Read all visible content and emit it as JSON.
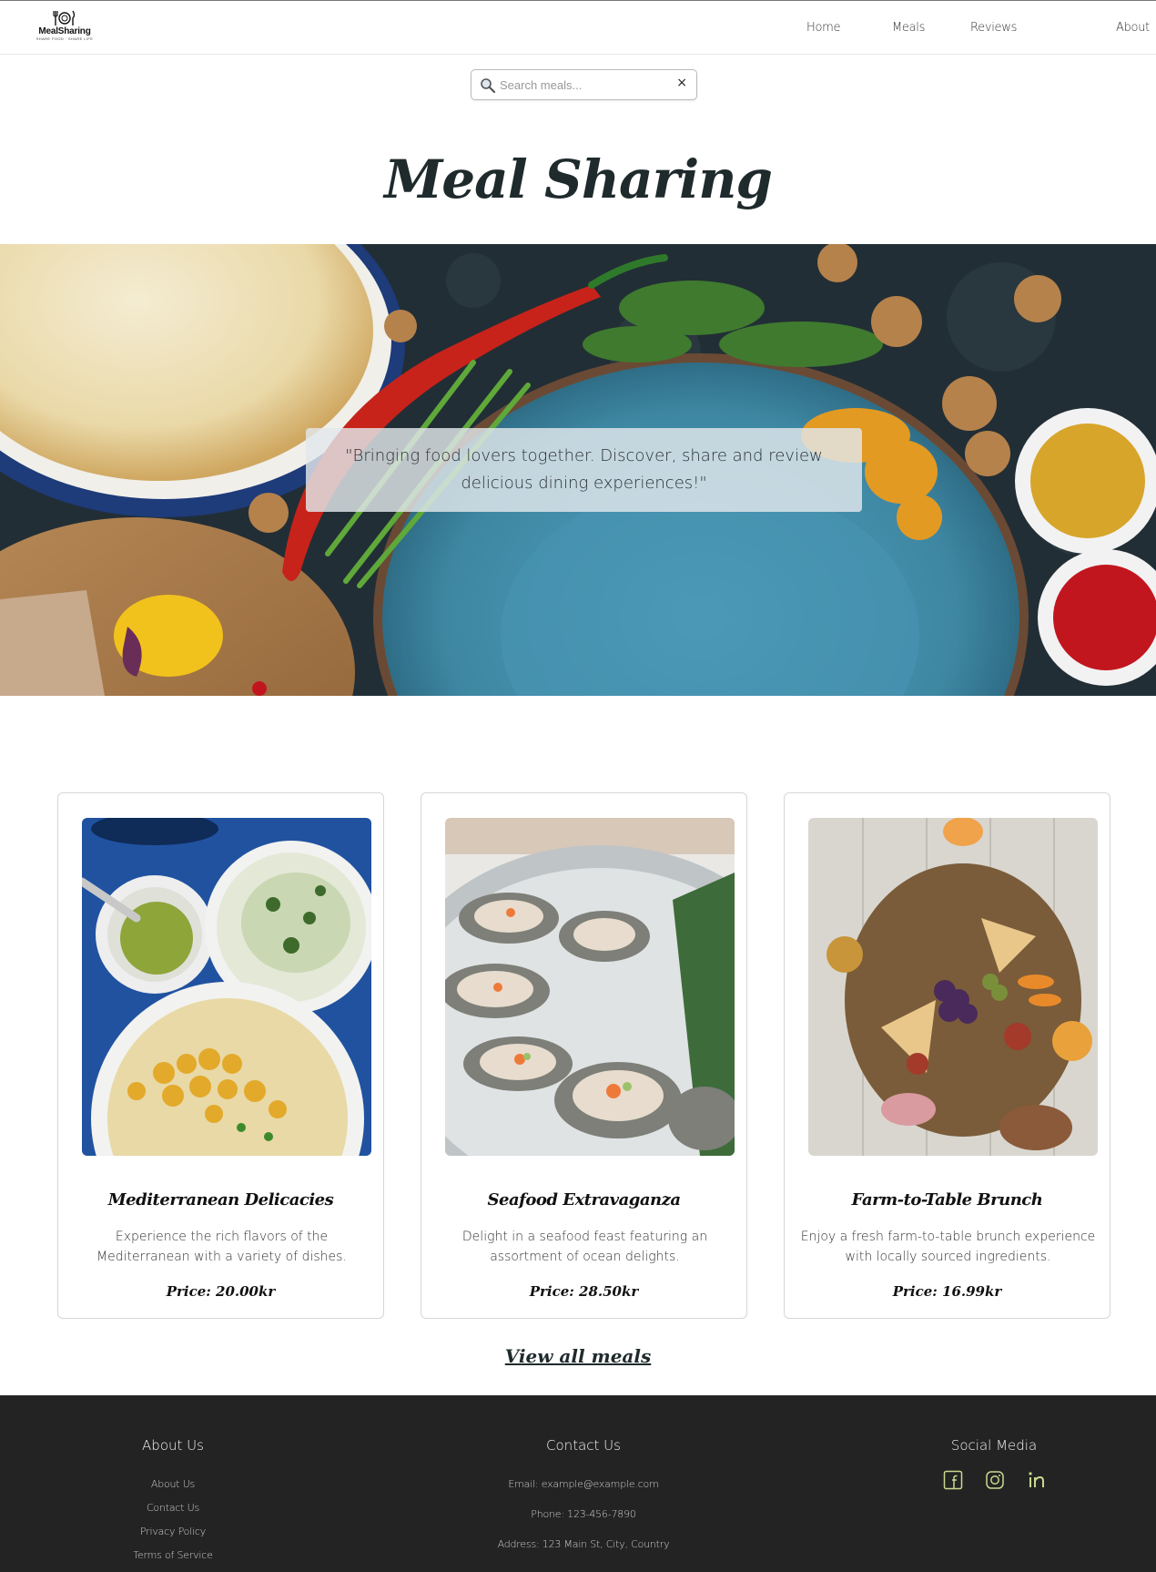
{
  "brand": {
    "logo_text": "MealSharing",
    "logo_sub": "SHARE FOOD · SHARE LIFE",
    "logo_icon": "fork-plate-knife-icon"
  },
  "nav": {
    "links": [
      "Home",
      "Meals",
      "Reviews",
      "About"
    ]
  },
  "search": {
    "placeholder": "Search meals...",
    "value": "",
    "clear_label": "×"
  },
  "hero": {
    "title": "Meal Sharing",
    "tagline": "\"Bringing food lovers together. Discover, share and review delicious dining experiences!\""
  },
  "meals": [
    {
      "title": "Mediterranean Delicacies",
      "description": "Experience the rich flavors of the Mediterranean with a variety of dishes.",
      "price": "Price: 20.00kr",
      "image": "mediterranean-dishes-photo"
    },
    {
      "title": "Seafood Extravaganza",
      "description": "Delight in a seafood feast featuring an assortment of ocean delights.",
      "price": "Price: 28.50kr",
      "image": "oysters-on-ice-photo"
    },
    {
      "title": "Farm-to-Table Brunch",
      "description": "Enjoy a fresh farm-to-table brunch experience with locally sourced ingredients.",
      "price": "Price: 16.99kr",
      "image": "charcuterie-board-photo"
    }
  ],
  "view_all": "View all meals",
  "footer": {
    "about": {
      "heading": "About Us",
      "links": [
        "About Us",
        "Contact Us",
        "Privacy Policy",
        "Terms of Service"
      ]
    },
    "contact": {
      "heading": "Contact Us",
      "email": "Email: example@example.com",
      "phone": "Phone: 123-456-7890",
      "address": "Address: 123 Main St, City, Country"
    },
    "social": {
      "heading": "Social Media",
      "icons": [
        "facebook-icon",
        "instagram-icon",
        "linkedin-icon"
      ],
      "icon_color": "#c9d98f"
    }
  },
  "colors": {
    "footer_bg": "#232323",
    "heading": "#1f2a2c",
    "hero_plate": "#3f8aa6"
  }
}
